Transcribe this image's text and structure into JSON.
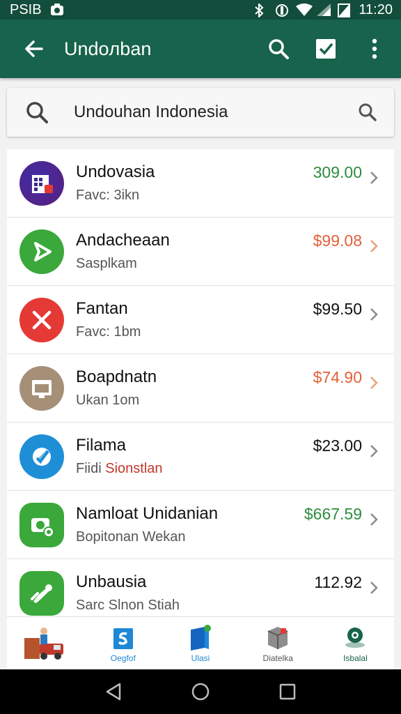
{
  "status_bar": {
    "left_text": "PSIB",
    "time": "11:20"
  },
  "app_bar": {
    "title": "Undoлban"
  },
  "search": {
    "value": "Undouhan Indonesia"
  },
  "items": [
    {
      "name": "Undovasia",
      "subtitle": "Favc: 3ikn",
      "subtitle_highlight": "",
      "price": "309.00",
      "price_color": "#2e8b3e",
      "icon_bg": "#3b2a8f",
      "icon": "calendar-icon"
    },
    {
      "name": "Andacheaan",
      "subtitle": "Sasplkam",
      "subtitle_highlight": "",
      "price": "$99.08",
      "price_color": "#e2603a",
      "icon_bg": "#3aa83b",
      "icon": "play-icon"
    },
    {
      "name": "Fantan",
      "subtitle": "Favc: 1bm",
      "subtitle_highlight": "",
      "price": "$99.50",
      "price_color": "#111111",
      "icon_bg": "#e53935",
      "icon": "close-icon"
    },
    {
      "name": "Boapdnatn",
      "subtitle": "Ukan 1om",
      "subtitle_highlight": "",
      "price": "$74.90",
      "price_color": "#e2603a",
      "icon_bg": "#a58f77",
      "icon": "monitor-icon"
    },
    {
      "name": "Filama",
      "subtitle": "Fiidi ",
      "subtitle_highlight": "Sionstlan",
      "price": "$23.00",
      "price_color": "#111111",
      "icon_bg": "#1e8fd6",
      "icon": "edit-icon"
    },
    {
      "name": "Namloat Unidanian",
      "subtitle": "Bopitonan Wekan",
      "subtitle_highlight": "",
      "price": "$667.59",
      "price_color": "#2e8b3e",
      "icon_bg": "#3aa83b",
      "icon": "camera-icon"
    },
    {
      "name": "Unbausia",
      "subtitle": "Sarc Slnon Stiah",
      "subtitle_highlight": "",
      "price": "112.92",
      "price_color": "#111111",
      "icon_bg": "#3aa83b",
      "icon": "phone-icon"
    }
  ],
  "bottom_nav": [
    {
      "label": "",
      "icon": "delivery-truck-icon",
      "color": "#555555"
    },
    {
      "label": "Oegfof",
      "icon": "shopify-bag-icon",
      "color": "#1e88d6"
    },
    {
      "label": "Ulasi",
      "icon": "book-icon",
      "color": "#1e88d6"
    },
    {
      "label": "Diatelka",
      "icon": "box-icon",
      "color": "#555555"
    },
    {
      "label": "Isbalal",
      "icon": "location-pin-icon",
      "color": "#17634b"
    }
  ]
}
